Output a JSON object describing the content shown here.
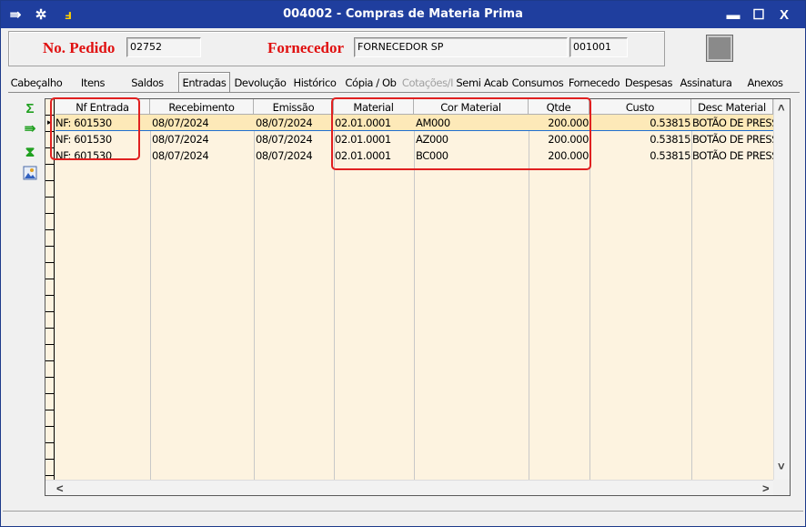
{
  "window": {
    "title": "004002 - Compras de Materia Prima",
    "buttons": {
      "minimize": "▬",
      "maximize": "☐",
      "close": "X"
    }
  },
  "header": {
    "pedido_label": "No. Pedido",
    "pedido_value": "02752",
    "fornecedor_label": "Fornecedor",
    "fornecedor_name": "FORNECEDOR SP",
    "fornecedor_code": "001001"
  },
  "tabs": [
    {
      "label": "Cabeçalho",
      "state": "normal"
    },
    {
      "label": "Itens",
      "state": "normal"
    },
    {
      "label": "Saldos",
      "state": "normal"
    },
    {
      "label": "Entradas",
      "state": "active"
    },
    {
      "label": "Devolução",
      "state": "normal"
    },
    {
      "label": "Histórico",
      "state": "normal"
    },
    {
      "label": "Cópia / Ob",
      "state": "normal"
    },
    {
      "label": "Cotações/I",
      "state": "disabled"
    },
    {
      "label": "Semi Acab",
      "state": "normal"
    },
    {
      "label": "Consumos",
      "state": "normal"
    },
    {
      "label": "Fornecedo",
      "state": "normal"
    },
    {
      "label": "Despesas",
      "state": "normal"
    },
    {
      "label": "Assinatura",
      "state": "normal"
    },
    {
      "label": "Anexos",
      "state": "normal"
    }
  ],
  "side_tools": [
    {
      "icon": "sigma-icon",
      "color": "#20a020"
    },
    {
      "icon": "export-icon",
      "color": "#20a020"
    },
    {
      "icon": "filter-down-icon",
      "color": "#20a020"
    },
    {
      "icon": "image-icon",
      "color": "#3060c0"
    }
  ],
  "grid": {
    "columns": [
      "Nf Entrada",
      "Recebimento",
      "Emissão",
      "Material",
      "Cor Material",
      "Qtde",
      "Custo",
      "Desc Material"
    ],
    "rows": [
      [
        "NF: 601530",
        "08/07/2024",
        "08/07/2024",
        "02.01.0001",
        "AM000",
        "200.000",
        "0.53815",
        "BOTÃO DE PRESSÃO"
      ],
      [
        "NF: 601530",
        "08/07/2024",
        "08/07/2024",
        "02.01.0001",
        "AZ000",
        "200.000",
        "0.53815",
        "BOTÃO DE PRESSÃO"
      ],
      [
        "NF: 601530",
        "08/07/2024",
        "08/07/2024",
        "02.01.0001",
        "BC000",
        "200.000",
        "0.53815",
        "BOTÃO DE PRESSÃO"
      ]
    ],
    "selected_row": 0,
    "scroll_icons": {
      "up": "˄",
      "down": "˅",
      "left": "<",
      "right": ">"
    }
  },
  "colors": {
    "titlebar": "#1f3e9e",
    "label_red": "#e01010",
    "grid_bg": "#fdf3e0",
    "selected_row": "#fde9b8",
    "annotation": "#e02020"
  }
}
